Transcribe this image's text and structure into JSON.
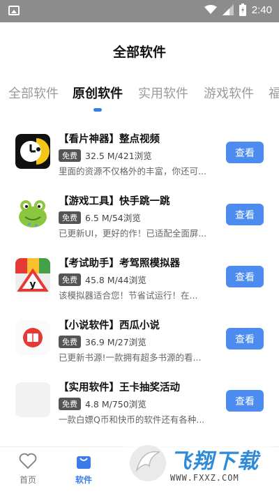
{
  "status_bar": {
    "time": "2:40"
  },
  "page_title": "全部软件",
  "tabs": [
    "全部软件",
    "原创软件",
    "实用软件",
    "游戏软件",
    "福"
  ],
  "active_tab_index": 1,
  "apps": [
    {
      "title": "【看片神器】整点视频",
      "badge": "免费",
      "meta": "32.5 M/421浏览",
      "desc": "里面的资源不仅格外的丰富，你还可...",
      "button": "查看",
      "icon": "clock-app-icon"
    },
    {
      "title": "【游戏工具】快手跳一跳",
      "badge": "免费",
      "meta": "6.5 M/54浏览",
      "desc": "已更新UI，更好的作！已适配全面屏...",
      "button": "查看",
      "icon": "frog-app-icon"
    },
    {
      "title": "【考试助手】考驾照模拟器",
      "badge": "免费",
      "meta": "45.8 M/44浏览",
      "desc": "该模拟器适合您！节省试运行！在...",
      "button": "查看",
      "icon": "road-sign-app-icon"
    },
    {
      "title": "【小说软件】西瓜小说",
      "badge": "免费",
      "meta": "36.9 M/27浏览",
      "desc": "已更新书源!一款拥有超多书源的看...",
      "button": "查看",
      "icon": "book-app-icon"
    },
    {
      "title": "【实用软件】王卡抽奖活动",
      "badge": "免费",
      "meta": "4.8 M/750浏览",
      "desc": "一款白嫖Q币和快币的软件还有各种...",
      "button": "查看",
      "icon": "blank-app-icon"
    }
  ],
  "bottom_nav": [
    {
      "label": "首页",
      "icon": "heart-icon"
    },
    {
      "label": "软件",
      "icon": "bag-icon"
    }
  ],
  "active_nav_index": 1,
  "watermark": {
    "text": "飞翔下载",
    "url": "WWW.FXXZ.COM"
  },
  "colors": {
    "accent": "#3a7bea",
    "button": "#4c8bf0"
  }
}
